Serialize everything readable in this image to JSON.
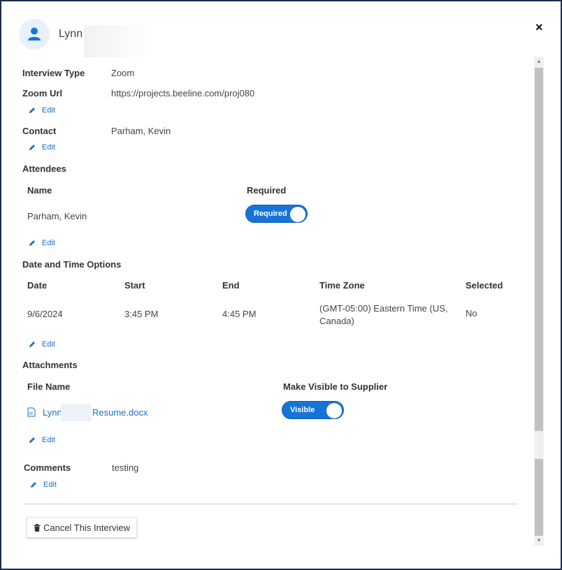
{
  "header": {
    "name": "Lynn",
    "close_label": "×"
  },
  "interview_type": {
    "label": "Interview Type",
    "value": "Zoom"
  },
  "zoom_url": {
    "label": "Zoom Url",
    "value": "https://projects.beeline.com/proj080"
  },
  "contact": {
    "label": "Contact",
    "value": "Parham, Kevin"
  },
  "attendees": {
    "label": "Attendees",
    "columns": [
      "Name",
      "Required"
    ],
    "rows": [
      {
        "name": "Parham, Kevin",
        "required": "Required"
      }
    ]
  },
  "date_time": {
    "label": "Date and Time Options",
    "columns": [
      "Date",
      "Start",
      "End",
      "Time Zone",
      "Selected"
    ],
    "rows": [
      {
        "date": "9/6/2024",
        "start": "3:45 PM",
        "end": "4:45 PM",
        "tz": "(GMT-05:00) Eastern Time (US, Canada)",
        "selected": "No"
      }
    ]
  },
  "attachments": {
    "label": "Attachments",
    "columns": [
      "File Name",
      "Make Visible to Supplier"
    ],
    "rows": [
      {
        "file_prefix": "Lynn",
        "file_suffix": "Resume.docx",
        "visible": "Visible"
      }
    ]
  },
  "comments": {
    "label": "Comments",
    "value": "testing"
  },
  "edit_label": "Edit",
  "cancel_button": "Cancel This Interview",
  "colors": {
    "accent": "#1674d6",
    "link": "#1a6fc9"
  }
}
